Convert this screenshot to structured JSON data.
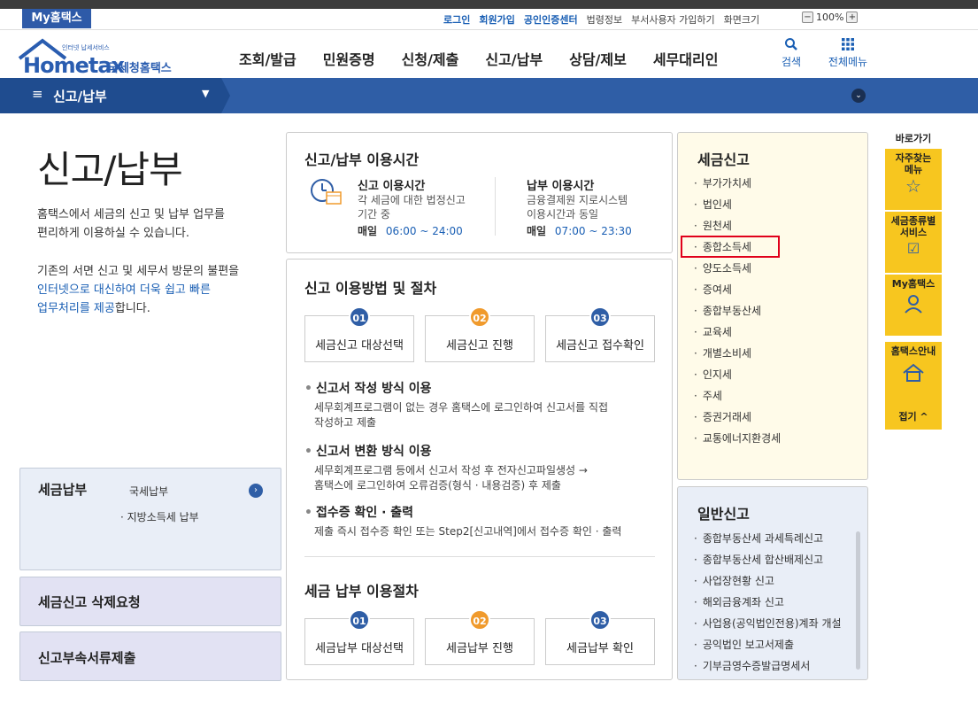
{
  "utility": {
    "my_tab": "My홈택스",
    "login": "로그인",
    "signup": "회원가입",
    "cert_center": "공인인증센터",
    "law_info": "법령정보",
    "dept_user_signup": "부서사용자 가입하기",
    "screen_size": "화면크기",
    "zoom": "100%"
  },
  "logo": {
    "main": "Hometax",
    "sub": "국세청홈택스",
    "tiny": "인터넷 납세서비스"
  },
  "gnb": [
    "조회/발급",
    "민원증명",
    "신청/제출",
    "신고/납부",
    "상담/제보",
    "세무대리인"
  ],
  "header": {
    "search": "검색",
    "all_menu": "전체메뉴"
  },
  "breadcrumb": "신고/납부",
  "page": {
    "title": "신고/납부",
    "desc1": "홈택스에서 세금의 신고 및 납부 업무를",
    "desc2": "편리하게 이용하실 수 있습니다.",
    "desc3": "기존의 서면 신고 및 세무서 방문의 불편을",
    "desc4": "인터넷으로 대신하여 더욱 쉽고 빠른",
    "desc5a": "업무처리를 제공",
    "desc5b": "합니다."
  },
  "left_boxes": {
    "payment": {
      "title": "세금납부",
      "national": "국세납부",
      "local": "· 지방소득세 납부"
    },
    "delete_request": "세금신고 삭제요청",
    "attachment": "신고부속서류제출"
  },
  "hours": {
    "title": "신고/납부 이용시간",
    "report": {
      "title": "신고 이용시간",
      "line1": "각 세금에 대한 법정신고",
      "line2": "기간 중",
      "daily": "매일",
      "time": "06:00 ~ 24:00"
    },
    "payment": {
      "title": "납부 이용시간",
      "line1": "금융결제원 지로시스템",
      "line2": "이용시간과 동일",
      "daily": "매일",
      "time": "07:00 ~ 23:30"
    }
  },
  "method": {
    "title": "신고 이용방법 및 절차",
    "steps": [
      {
        "num": "01",
        "label": "세금신고 대상선택"
      },
      {
        "num": "02",
        "label": "세금신고 진행"
      },
      {
        "num": "03",
        "label": "세금신고 접수확인"
      }
    ],
    "items": [
      {
        "title": "신고서 작성 방식 이용",
        "desc1": "세무회계프로그램이 없는 경우 홈택스에 로그인하여 신고서를 직접",
        "desc2": "작성하고 제출"
      },
      {
        "title": "신고서 변환 방식 이용",
        "desc1": "세무회계프로그램 등에서 신고서 작성 후 전자신고파일생성 →",
        "desc2": "홈택스에 로그인하여 오류검증(형식 · 내용검증) 후 제출"
      },
      {
        "title": "접수증 확인 · 출력",
        "desc1": "제출 즉시 접수증 확인 또는 Step2[신고내역]에서 접수증 확인 · 출력",
        "desc2": ""
      }
    ]
  },
  "payproc": {
    "title": "세금 납부 이용절차",
    "steps": [
      {
        "num": "01",
        "label": "세금납부 대상선택"
      },
      {
        "num": "02",
        "label": "세금납부 진행"
      },
      {
        "num": "03",
        "label": "세금납부 확인"
      }
    ]
  },
  "tax_report": {
    "title": "세금신고",
    "items": [
      "부가가치세",
      "법인세",
      "원천세",
      "종합소득세",
      "양도소득세",
      "증여세",
      "종합부동산세",
      "교육세",
      "개별소비세",
      "인지세",
      "주세",
      "증권거래세",
      "교통에너지환경세"
    ]
  },
  "general_report": {
    "title": "일반신고",
    "items": [
      "종합부동산세 과세특례신고",
      "종합부동산세 합산배제신고",
      "사업장현황 신고",
      "해외금융계좌 신고",
      "사업용(공익법인전용)계좌 개설",
      "공익법인 보고서제출",
      "기부금영수증발급명세서"
    ]
  },
  "quick": {
    "title": "바로가기",
    "faq1": "자주찾는",
    "faq2": "메뉴",
    "service1": "세금종류별",
    "service2": "서비스",
    "myhometax": "My홈택스",
    "guide": "홈택스안내",
    "fold": "접기 ^"
  },
  "colors": {
    "brand_blue": "#2f5ea6",
    "orange": "#f09a2c",
    "highlight": "#e0001b",
    "quick_yellow": "#f7c61f"
  }
}
